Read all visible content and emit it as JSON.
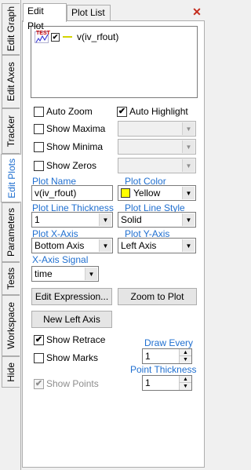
{
  "side_tabs": [
    "Edit Graph",
    "Edit Axes",
    "Tracker",
    "Edit Plots",
    "Parameters",
    "Tests",
    "Workspace",
    "Hide"
  ],
  "top_tabs": [
    "Edit Plot",
    "Plot List"
  ],
  "close_glyph": "✕",
  "plot_list": {
    "icon_text": "TEST",
    "item_label": "v(iv_rfout)",
    "checked": true
  },
  "checkboxes": {
    "auto_zoom": {
      "label": "Auto Zoom",
      "checked": false
    },
    "auto_highlight": {
      "label": "Auto Highlight",
      "checked": true
    },
    "show_maxima": {
      "label": "Show Maxima",
      "checked": false
    },
    "show_minima": {
      "label": "Show Minima",
      "checked": false
    },
    "show_zeros": {
      "label": "Show Zeros",
      "checked": false
    },
    "show_retrace": {
      "label": "Show Retrace",
      "checked": true
    },
    "show_marks": {
      "label": "Show Marks",
      "checked": false
    },
    "show_points": {
      "label": "Show Points",
      "checked": true,
      "disabled": true
    }
  },
  "labels": {
    "plot_name": "Plot Name",
    "plot_color": "Plot Color",
    "plot_line_thickness": "Plot Line Thickness",
    "plot_line_style": "Plot Line Style",
    "plot_x_axis": "Plot X-Axis",
    "plot_y_axis": "Plot Y-Axis",
    "x_axis_signal": "X-Axis Signal",
    "draw_every": "Draw Every",
    "point_thickness": "Point Thickness"
  },
  "values": {
    "plot_name": "v(iv_rfout)",
    "plot_color": "Yellow",
    "plot_line_thickness": "1",
    "plot_line_style": "Solid",
    "plot_x_axis": "Bottom Axis",
    "plot_y_axis": "Left Axis",
    "x_axis_signal": "time",
    "draw_every": "1",
    "point_thickness": "1"
  },
  "buttons": {
    "edit_expression": "Edit Expression...",
    "zoom_to_plot": "Zoom to Plot",
    "new_left_axis": "New Left Axis"
  },
  "glyphs": {
    "check": "✔",
    "combo_arrow": "▼",
    "spin_up": "▲",
    "spin_down": "▼"
  },
  "colors": {
    "accent_blue": "#1f6fd0",
    "plot_color": "#ffff00",
    "close_red": "#c42b1c"
  }
}
